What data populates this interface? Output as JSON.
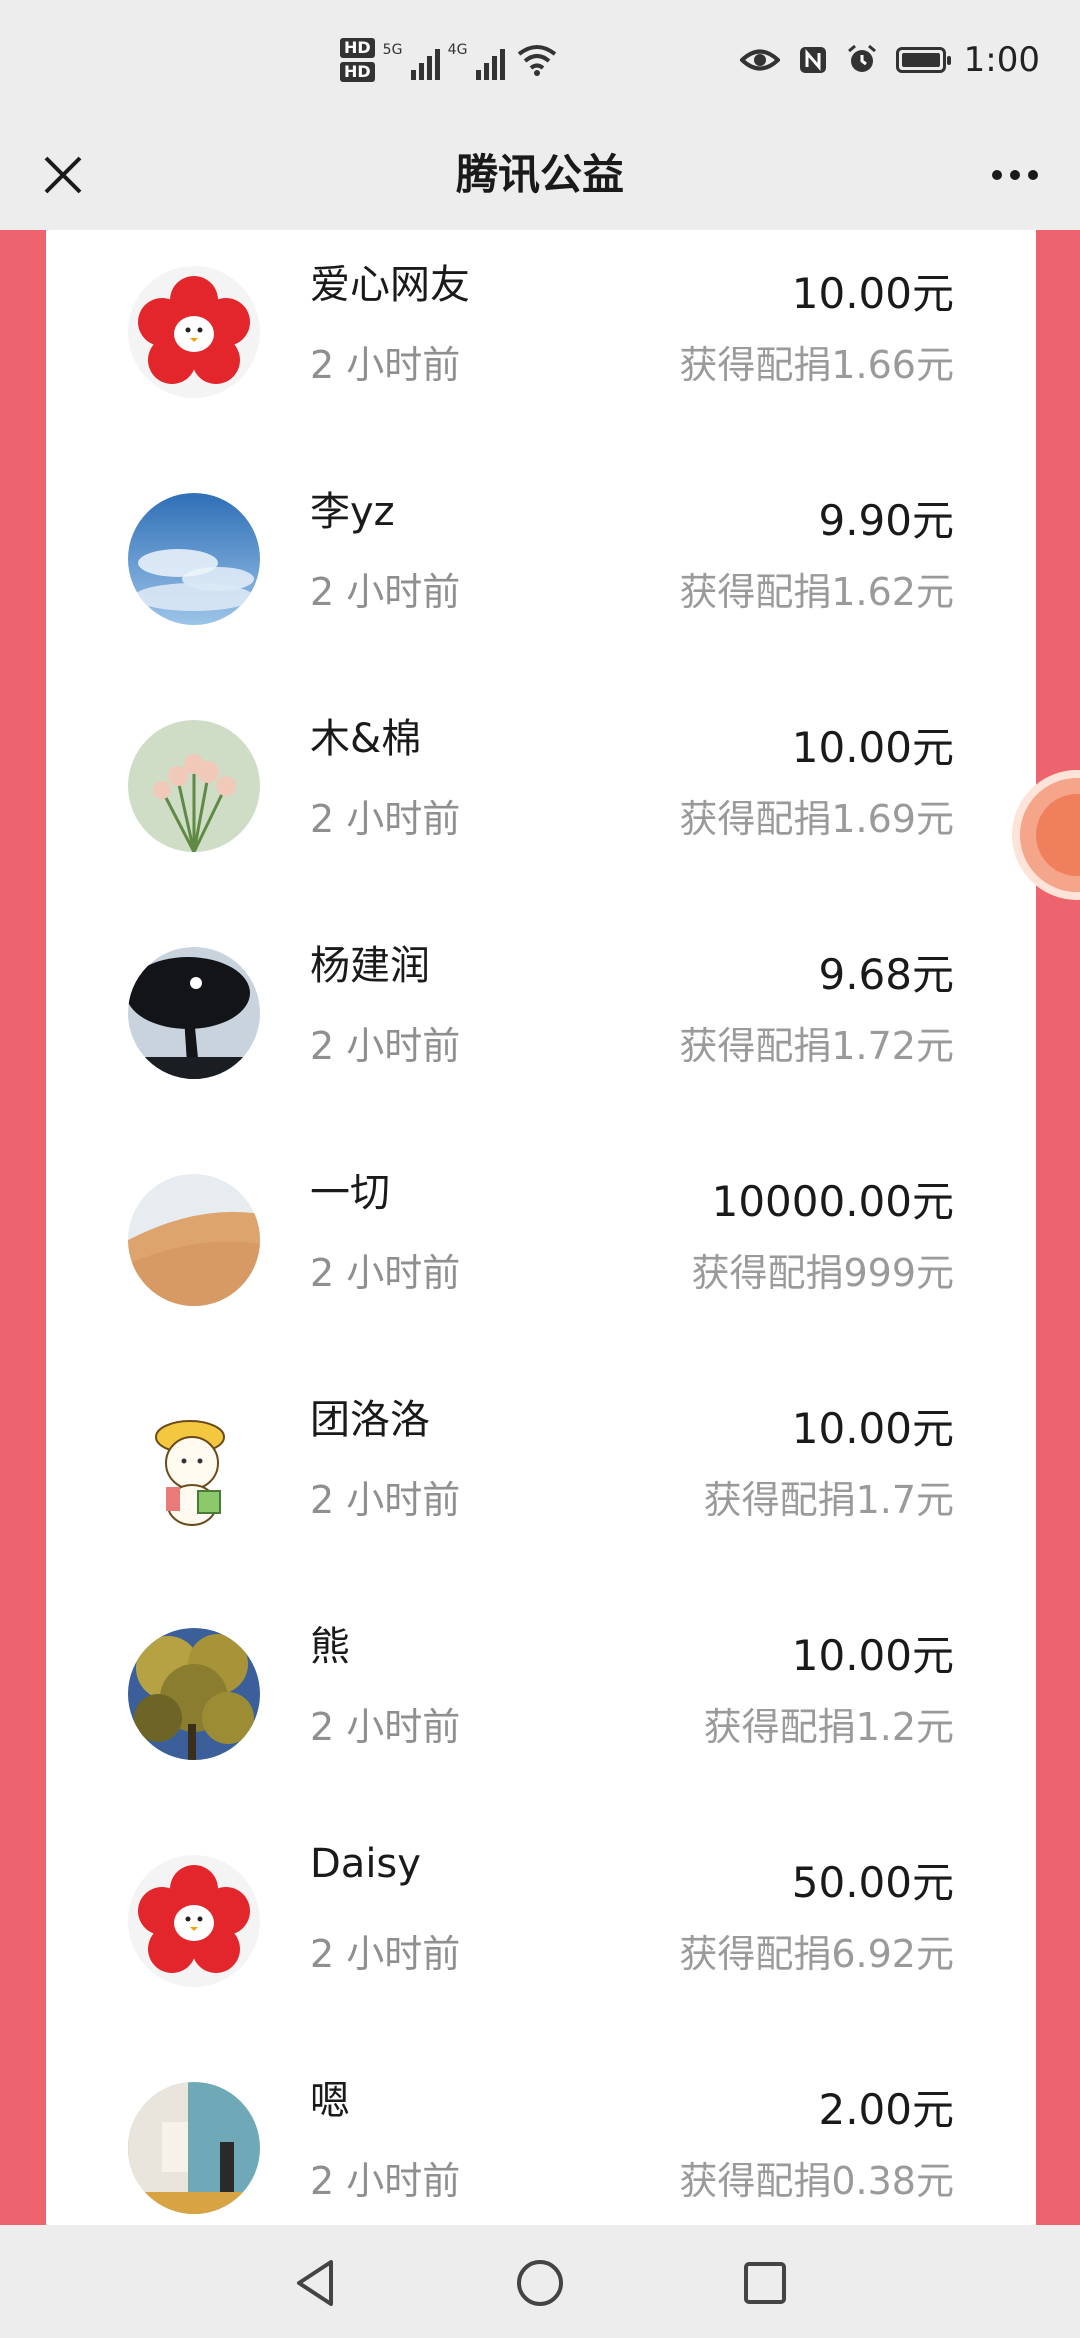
{
  "status_bar": {
    "hd1": "HD",
    "hd2": "HD",
    "net1": "5G",
    "net2": "4G",
    "time": "1:00"
  },
  "navbar": {
    "title": "腾讯公益"
  },
  "donations": [
    {
      "name": "爱心网友",
      "time": "2 小时前",
      "amount": "10.00元",
      "match": "获得配捐1.66元",
      "avatar": "red-flower"
    },
    {
      "name": "李yz",
      "time": "2 小时前",
      "amount": "9.90元",
      "match": "获得配捐1.62元",
      "avatar": "sky"
    },
    {
      "name": "木&棉",
      "time": "2 小时前",
      "amount": "10.00元",
      "match": "获得配捐1.69元",
      "avatar": "flowers"
    },
    {
      "name": "杨建润",
      "time": "2 小时前",
      "amount": "9.68元",
      "match": "获得配捐1.72元",
      "avatar": "tree-night"
    },
    {
      "name": "一切",
      "time": "2 小时前",
      "amount": "10000.00元",
      "match": "获得配捐999元",
      "avatar": "desert"
    },
    {
      "name": "团洛洛",
      "time": "2 小时前",
      "amount": "10.00元",
      "match": "获得配捐1.7元",
      "avatar": "cartoon"
    },
    {
      "name": "熊",
      "time": "2 小时前",
      "amount": "10.00元",
      "match": "获得配捐1.2元",
      "avatar": "tree-yellow"
    },
    {
      "name": "Daisy",
      "time": "2 小时前",
      "amount": "50.00元",
      "match": "获得配捐6.92元",
      "avatar": "red-flower"
    },
    {
      "name": "嗯",
      "time": "2 小时前",
      "amount": "2.00元",
      "match": "获得配捐0.38元",
      "avatar": "room"
    }
  ],
  "colors": {
    "side_background": "#ee646e",
    "card_background": "#ffffff",
    "secondary_text": "#9a9a9a"
  }
}
